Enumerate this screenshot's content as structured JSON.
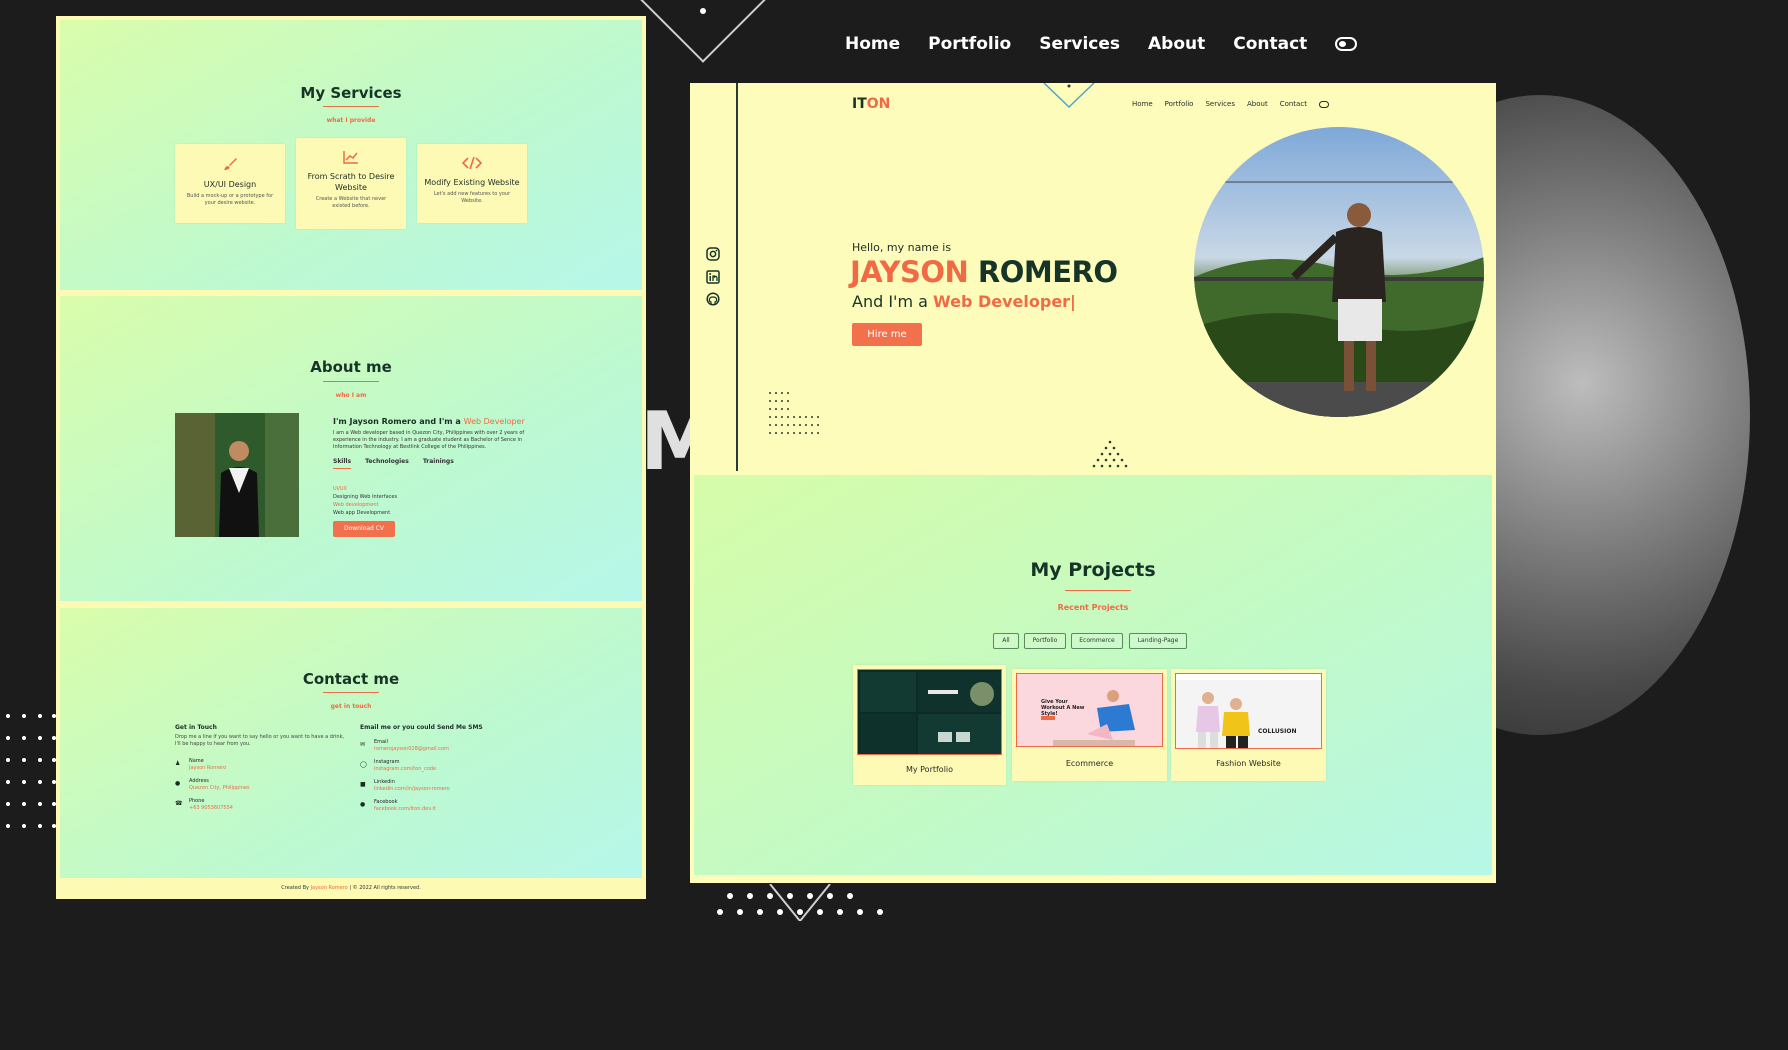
{
  "top_nav": {
    "items": [
      "Home",
      "Portfolio",
      "Services",
      "About",
      "Contact"
    ]
  },
  "background_text": "ME",
  "services": {
    "title": "My Services",
    "subtitle": "what I provide",
    "cards": [
      {
        "icon": "paintbrush-icon",
        "title": "UX/UI Design",
        "desc": "Build a mock-up or a prototype for your desire website."
      },
      {
        "icon": "chart-line-icon",
        "title": "From Scrath to Desire Website",
        "desc": "Create a Website that never existed before."
      },
      {
        "icon": "code-icon",
        "title": "Modify Existing Website",
        "desc": "Let's add new features to your Website."
      }
    ]
  },
  "about": {
    "title": "About me",
    "subtitle": "who I am",
    "heading_prefix": "I'm Jayson Romero and I'm a",
    "heading_role": "Web Developer",
    "paragraph": "I am a Web developer based in Quezon City, Philippines with over 2 years of experience in the industry. I am a graduate student as Bachelor of Sence in Information Technology at Bestlink College of the Philippines.",
    "tabs": [
      "Skills",
      "Technologies",
      "Trainings"
    ],
    "skills": [
      {
        "name": "UI/UX",
        "detail": "Designing Web Interfaces"
      },
      {
        "name": "Web development",
        "detail": "Web app Development"
      }
    ],
    "cta": "Download CV"
  },
  "contact": {
    "title": "Contact me",
    "subtitle": "get in touch",
    "left_heading": "Get in Touch",
    "left_text": "Drop me a line if you want to say hello or you want to have a drink, I'll be happy to hear from you.",
    "left_items": [
      {
        "icon": "user-icon",
        "label": "Name",
        "value": "Jayson Romero"
      },
      {
        "icon": "location-pin-icon",
        "label": "Address",
        "value": "Quezon City, Philippines"
      },
      {
        "icon": "phone-icon",
        "label": "Phone",
        "value": "+63 9053607554"
      }
    ],
    "right_heading": "Email me or you could Send Me SMS",
    "right_items": [
      {
        "icon": "envelope-icon",
        "label": "Email",
        "value": "romerojayson028@gmail.com"
      },
      {
        "icon": "instagram-icon",
        "label": "Instagram",
        "value": "instagram.com/ton_code"
      },
      {
        "icon": "linkedin-icon",
        "label": "Linkedin",
        "value": "linkedin.com/in/jayson-romero"
      },
      {
        "icon": "facebook-icon",
        "label": "Facebook",
        "value": "facebook.com/iton.dev.it"
      }
    ]
  },
  "footer": {
    "prefix": "Created By",
    "name": "Jayson Romero",
    "suffix": "| © 2022 All rights reserved."
  },
  "site": {
    "logo_a": "IT",
    "logo_b": "ON",
    "nav": [
      "Home",
      "Portfolio",
      "Services",
      "About",
      "Contact"
    ],
    "greeting": "Hello, my name is",
    "first_name": "JAYSON",
    "last_name": "ROMERO",
    "role_prefix": "And I'm a",
    "role": "Web Developer|",
    "cta": "Hire me"
  },
  "projects": {
    "title": "My Projects",
    "subtitle": "Recent Projects",
    "filters": [
      "All",
      "Portfolio",
      "Ecommerce",
      "Landing-Page"
    ],
    "items": [
      {
        "label": "My Portfolio"
      },
      {
        "label": "Ecommerce",
        "shot_text": "Give Your Workout A New Style!"
      },
      {
        "label": "Fashion Website",
        "shot_text": "COLLUSION"
      }
    ]
  },
  "colors": {
    "accent": "#f06a45",
    "dark": "#163428",
    "cream": "#fdfab5",
    "mint": "#bdf9d0"
  }
}
